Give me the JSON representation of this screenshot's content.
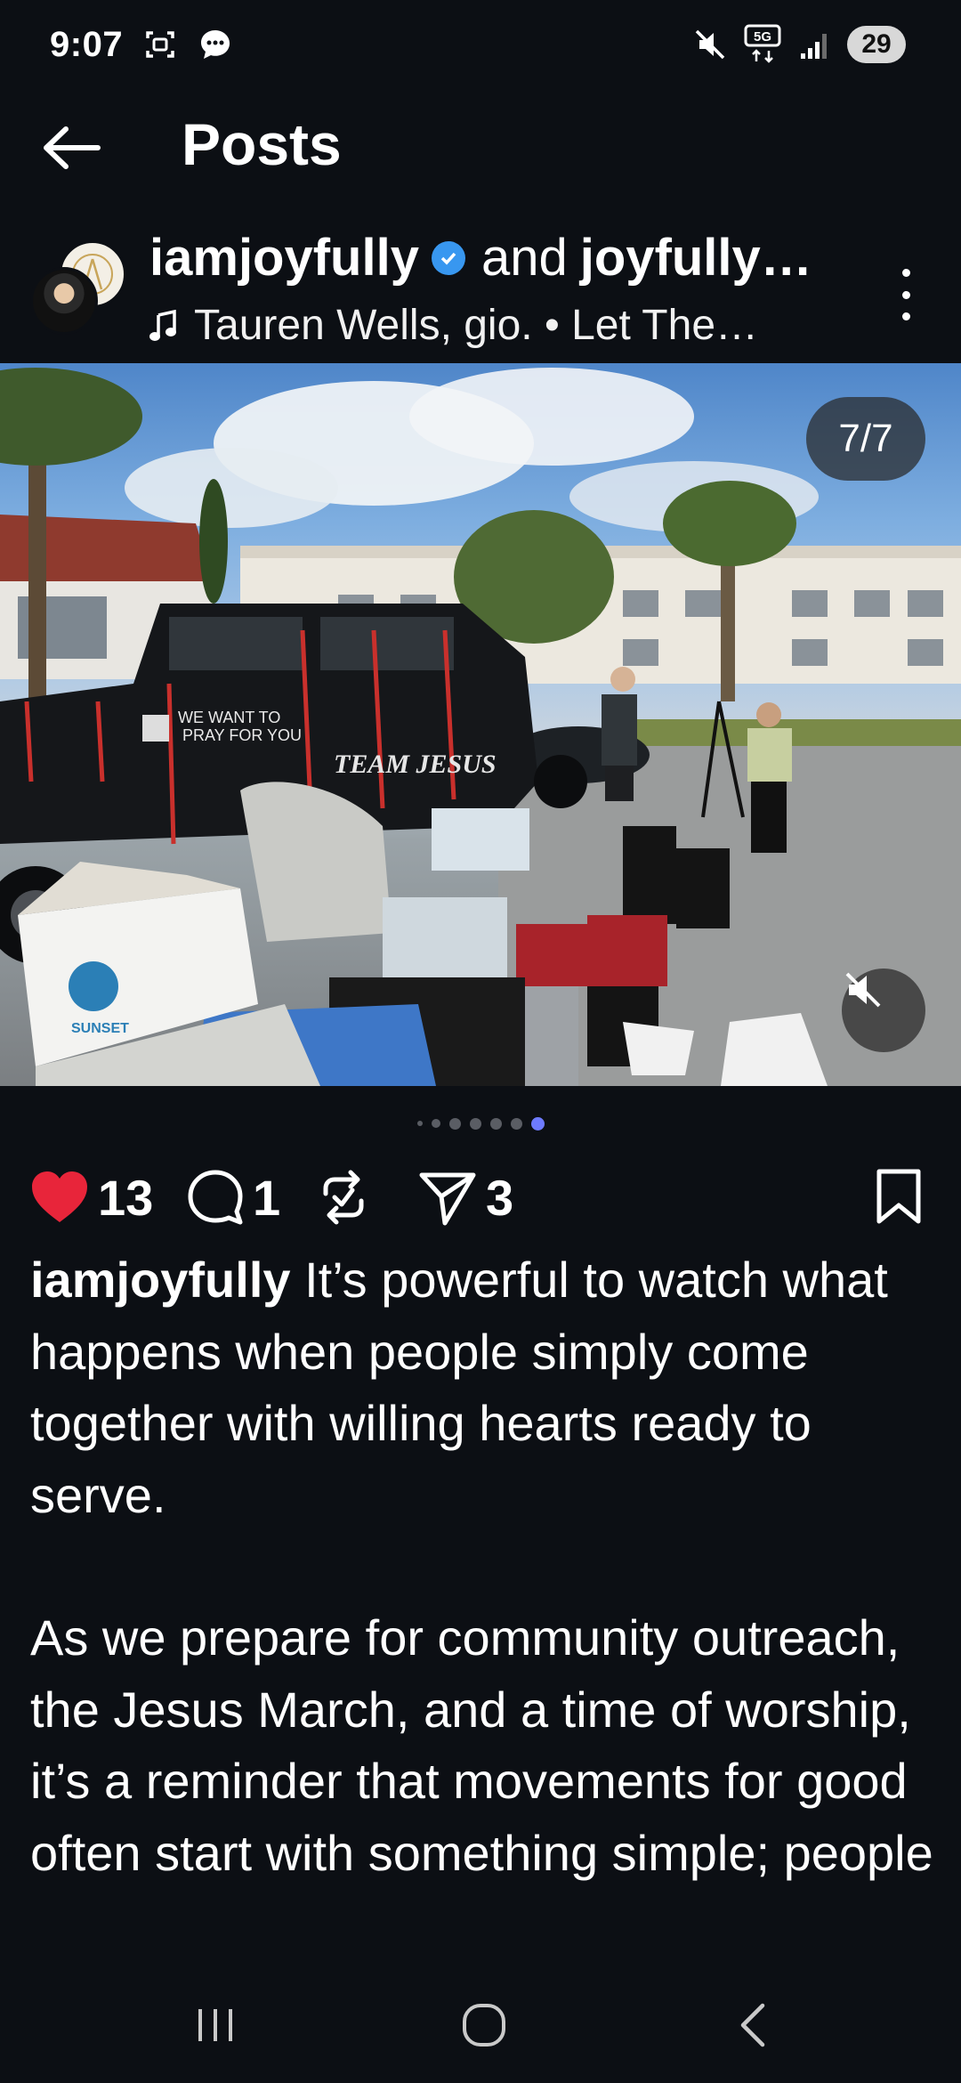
{
  "status_bar": {
    "time": "9:07",
    "network": "5G",
    "battery": "29"
  },
  "header": {
    "title": "Posts"
  },
  "post": {
    "username": "iamjoyfully",
    "connector": "and",
    "collaborator": "joyfully…",
    "music": "Tauren Wells, gio. • Let The…",
    "page_counter": "7/7",
    "image_texts": {
      "truck_sign_1": "WE WANT TO",
      "truck_sign_2": "PRAY FOR YOU",
      "truck_team": "TEAM JESUS",
      "box_brand": "SUNSET"
    },
    "carousel": {
      "total": 7,
      "current": 7
    },
    "likes": "13",
    "comments": "1",
    "shares": "3",
    "caption_username": "iamjoyfully",
    "caption_line1": " It’s powerful to watch what happens when people simply come together with willing hearts ready to serve.",
    "caption_line2": "As we prepare for community outreach, the Jesus March, and a time of worship, it’s a reminder that movements for good often start with something simple; people"
  },
  "colors": {
    "background": "#0c0f14",
    "heart": "#e8253a",
    "verified": "#3897f0",
    "active_dot": "#6e7bff"
  },
  "icons": {
    "back": "arrow-left-icon",
    "more": "more-vertical-icon",
    "like": "heart-filled-icon",
    "comment": "comment-icon",
    "repost": "repost-icon",
    "share": "send-icon",
    "save": "bookmark-icon",
    "mute": "speaker-muted-icon"
  }
}
